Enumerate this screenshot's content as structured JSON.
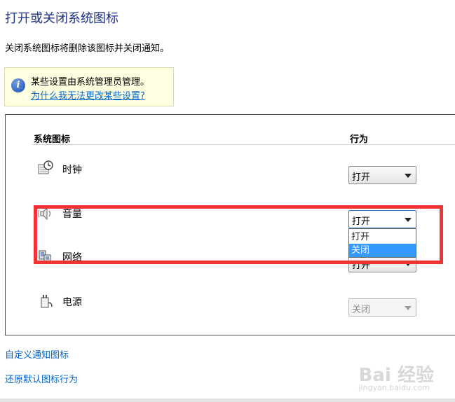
{
  "page": {
    "title": "打开或关闭系统图标",
    "description": "关闭系统图标将删除该图标并关闭通知。"
  },
  "info": {
    "icon": "info-icon",
    "text": "某些设置由系统管理员管理。",
    "link": "为什么我无法更改某些设置?"
  },
  "table": {
    "col_icons": "系统图标",
    "col_behavior": "行为",
    "rows": [
      {
        "icon": "clock-icon",
        "label": "时钟",
        "value": "打开",
        "disabled": false
      },
      {
        "icon": "volume-icon",
        "label": "音量",
        "value": "打开",
        "disabled": false,
        "open": true
      },
      {
        "icon": "network-icon",
        "label": "网络",
        "value": "打开",
        "disabled": false
      },
      {
        "icon": "power-icon",
        "label": "电源",
        "value": "关闭",
        "disabled": true
      }
    ],
    "dropdown_options": [
      "打开",
      "关闭"
    ],
    "dropdown_highlighted": "关闭"
  },
  "links": {
    "customize": "自定义通知图标",
    "restore": "还原默认图标行为"
  },
  "watermark": {
    "main": "Bai 经验",
    "sub": "jingyan.baidu.com"
  },
  "colors": {
    "title": "#1e3287",
    "link": "#0066cc",
    "highlight": "#3399ff",
    "annotation": "#ee3434"
  }
}
